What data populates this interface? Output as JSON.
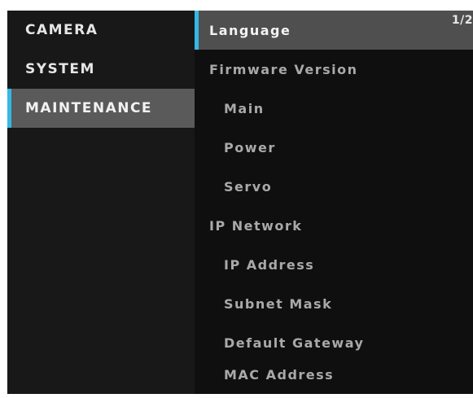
{
  "left_menu": {
    "items": [
      {
        "label": "CAMERA"
      },
      {
        "label": "SYSTEM"
      },
      {
        "label": "MAINTENANCE",
        "selected": true
      }
    ]
  },
  "right_menu": {
    "page_indicator": "1/2",
    "items": [
      {
        "label": "Language",
        "selected": true
      },
      {
        "label": "Firmware Version"
      },
      {
        "label": "Main"
      },
      {
        "label": "Power"
      },
      {
        "label": "Servo"
      },
      {
        "label": "IP Network"
      },
      {
        "label": "IP Address"
      },
      {
        "label": "Subnet Mask"
      },
      {
        "label": "Default Gateway"
      },
      {
        "label": "MAC Address"
      }
    ]
  },
  "colors": {
    "accent": "#35b8e6",
    "selected_left": "#5a5a5a",
    "selected_right": "#4f4f4f",
    "background": "#141414"
  }
}
